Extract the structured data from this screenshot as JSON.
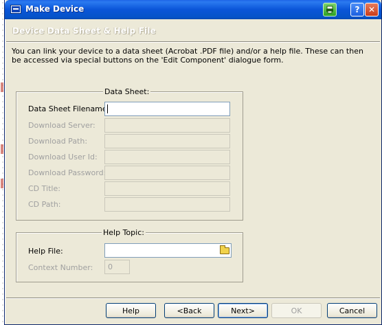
{
  "window": {
    "title": "Make Device"
  },
  "header": {
    "section_title": "Device Data Sheet & Help File"
  },
  "description": "You can link your device to a data sheet (Acrobat .PDF file) and/or a help file. These can then be accessed via special buttons on the 'Edit Component' dialogue form.",
  "data_sheet": {
    "group_title": "Data Sheet:",
    "rows": [
      {
        "label": "Data Sheet Filename:",
        "value": "",
        "enabled": true
      },
      {
        "label": "Download Server:",
        "value": "",
        "enabled": false
      },
      {
        "label": "Download Path:",
        "value": "",
        "enabled": false
      },
      {
        "label": "Download User Id:",
        "value": "",
        "enabled": false
      },
      {
        "label": "Download Password:",
        "value": "",
        "enabled": false
      },
      {
        "label": "CD Title:",
        "value": "",
        "enabled": false
      },
      {
        "label": "CD Path:",
        "value": "",
        "enabled": false
      }
    ]
  },
  "help_topic": {
    "group_title": "Help Topic:",
    "help_file_label": "Help File:",
    "help_file_value": "",
    "context_label": "Context Number:",
    "context_value": "0"
  },
  "buttons": {
    "help": "Help",
    "back": "<Back",
    "next": "Next>",
    "ok": "OK",
    "cancel": "Cancel"
  },
  "icons": {
    "app": "app-icon",
    "print": "print-icon",
    "help": "help-icon",
    "close": "close-icon",
    "browse": "folder-icon"
  }
}
